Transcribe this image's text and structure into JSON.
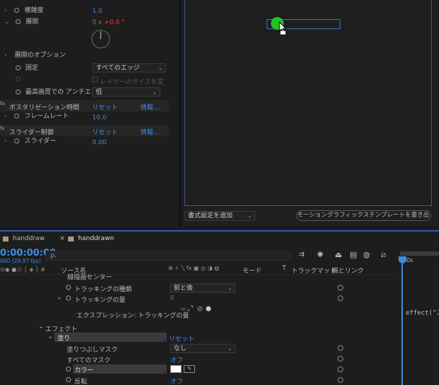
{
  "effects": {
    "complexity_label": "複雑度",
    "complexity_value": "1.0",
    "evolution_label": "展開",
    "evolution_value": "0 x +0.0 °",
    "evolution_options_label": "展開のオプション",
    "fixed_label": "固定",
    "fixed_value": "すべてのエッジ",
    "layer_size_label": "レイヤーのサイズを変",
    "best_quality_label": "最高画質での アンチエ",
    "best_quality_value": "低",
    "posterize_label": "ポスタリゼーション時間",
    "posterize_reset": "リセット",
    "posterize_info": "情報...",
    "framerate_label": "フレームレート",
    "framerate_value": "10.0",
    "slider_control_label": "スライダー制御",
    "slider_control_reset": "リセット",
    "slider_control_info": "情報...",
    "slider_label": "スライダー",
    "slider_value": "0.00",
    "fx_mark": "fx"
  },
  "preview": {
    "add_format_label": "書式設定を追加",
    "motion_template_label": "モーショングラフィックステンプレートを書き出し..."
  },
  "timeline": {
    "tab1_label": "handdraw",
    "tab2_label": "handdraw",
    "timecode": "0:00:00:00",
    "fps": "000 (29.97 fps)",
    "search_placeholder": "ρ.",
    "col_source_name": "ソース名",
    "col_mode": "モード",
    "col_trackmatte": "トラックマット",
    "col_parent": "親とリンク",
    "ruler_label": "00s",
    "rows": {
      "truncated_label": "線描画センター",
      "tracking_type_label": "トラッキングの種類",
      "tracking_type_value": "前と後",
      "tracking_amount_label": "トラッキングの量",
      "tracking_amount_value": "0",
      "expression_label": "エクスプレッション: トラッキングの量",
      "expression_code": "effect(\"ス",
      "effect_label": "エフェクト",
      "fill_label": "塗り",
      "fill_reset": "リセット",
      "fill_mask_label": "塗りつぶしマスク",
      "fill_mask_value": "なし",
      "all_masks_label": "すべてのマスク",
      "all_masks_value": "オフ",
      "color_label": "カラー",
      "invert_label": "反転",
      "invert_value": "オフ"
    }
  },
  "colors": {
    "accent": "#3a8ee6",
    "cursor_green": "#22c21f",
    "value_red": "#d94a4a"
  }
}
